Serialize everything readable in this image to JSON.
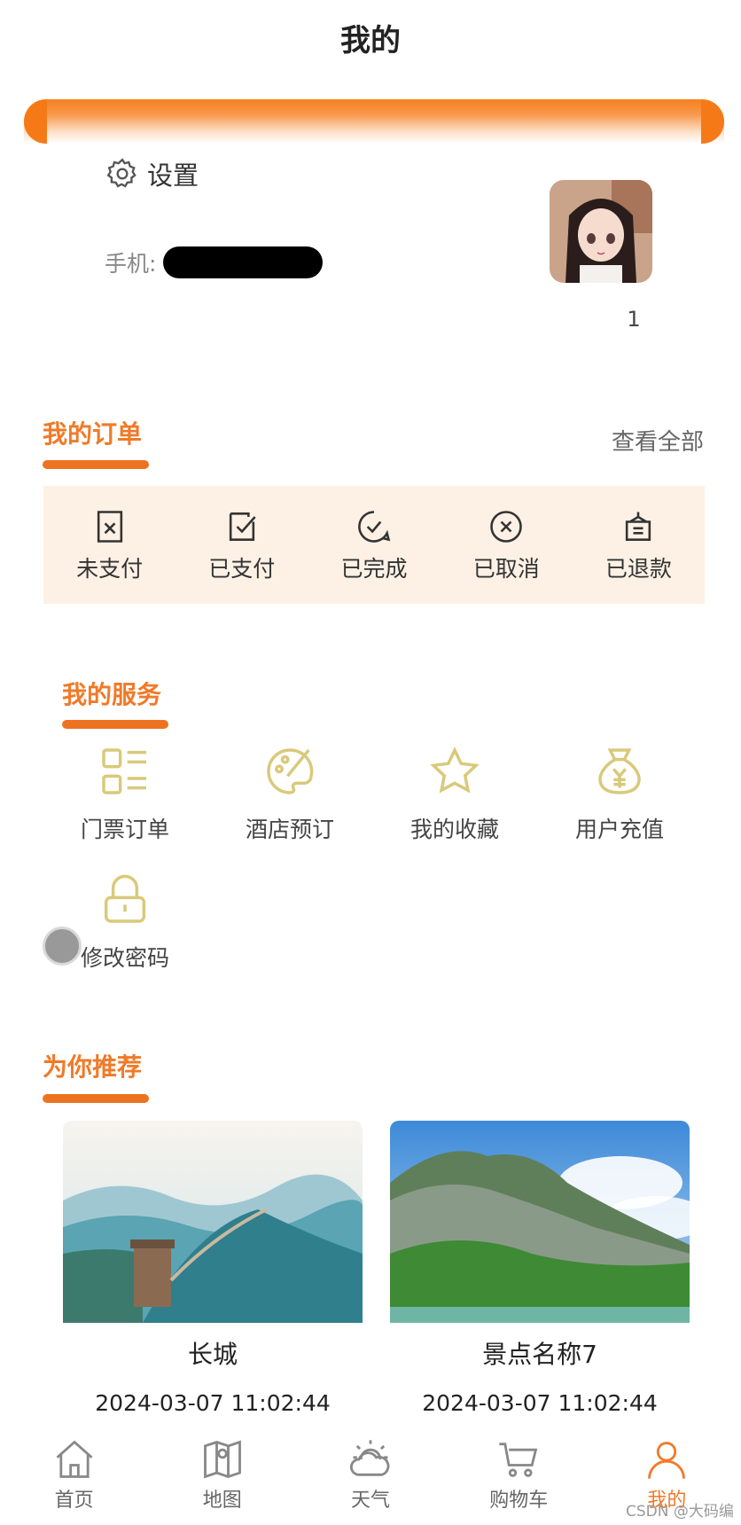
{
  "header": {
    "title": "我的"
  },
  "profile": {
    "settings_label": "设置",
    "phone_label": "手机:",
    "username": "1"
  },
  "orders": {
    "title": "我的订单",
    "view_all": "查看全部",
    "items": [
      {
        "label": "未支付",
        "icon": "unpaid-icon"
      },
      {
        "label": "已支付",
        "icon": "paid-icon"
      },
      {
        "label": "已完成",
        "icon": "completed-icon"
      },
      {
        "label": "已取消",
        "icon": "cancelled-icon"
      },
      {
        "label": "已退款",
        "icon": "refunded-icon"
      }
    ]
  },
  "services": {
    "title": "我的服务",
    "items": [
      {
        "label": "门票订单",
        "icon": "ticket-list-icon"
      },
      {
        "label": "酒店预订",
        "icon": "palette-icon"
      },
      {
        "label": "我的收藏",
        "icon": "star-icon"
      },
      {
        "label": "用户充值",
        "icon": "money-bag-icon"
      },
      {
        "label": "修改密码",
        "icon": "lock-icon"
      }
    ]
  },
  "recommend": {
    "title": "为你推荐",
    "cards": [
      {
        "name": "长城",
        "time": "2024-03-07 11:02:44"
      },
      {
        "name": "景点名称7",
        "time": "2024-03-07 11:02:44"
      }
    ]
  },
  "tabbar": {
    "items": [
      {
        "label": "首页",
        "icon": "home-icon"
      },
      {
        "label": "地图",
        "icon": "map-icon"
      },
      {
        "label": "天气",
        "icon": "weather-icon"
      },
      {
        "label": "购物车",
        "icon": "cart-icon"
      },
      {
        "label": "我的",
        "icon": "user-icon",
        "active": true
      }
    ]
  },
  "watermark": "CSDN @大码编程",
  "colors": {
    "accent": "#f07a28",
    "order_bg": "#fdf1e5",
    "service_icon": "#d9c97a"
  }
}
